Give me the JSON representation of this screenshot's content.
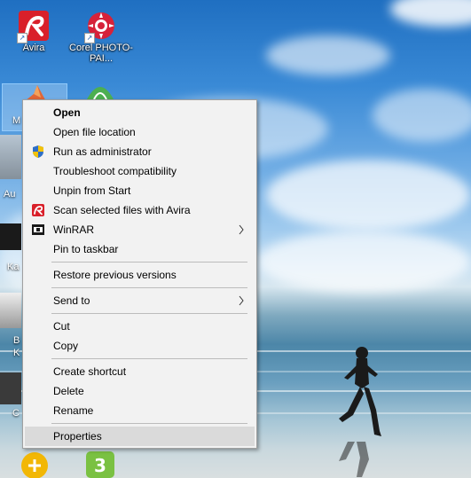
{
  "desktop": {
    "icons": [
      {
        "label": "Avira"
      },
      {
        "label": "Corel PHOTO-PAI..."
      }
    ],
    "partial_labels": [
      "M",
      "Au",
      "Ka",
      "B",
      "K",
      "C"
    ]
  },
  "context_menu": {
    "items": [
      {
        "label": "Open"
      },
      {
        "label": "Open file location"
      },
      {
        "label": "Run as administrator"
      },
      {
        "label": "Troubleshoot compatibility"
      },
      {
        "label": "Unpin from Start"
      },
      {
        "label": "Scan selected files with Avira"
      },
      {
        "label": "WinRAR"
      },
      {
        "label": "Pin to taskbar"
      },
      {
        "label": "Restore previous versions"
      },
      {
        "label": "Send to"
      },
      {
        "label": "Cut"
      },
      {
        "label": "Copy"
      },
      {
        "label": "Create shortcut"
      },
      {
        "label": "Delete"
      },
      {
        "label": "Rename"
      },
      {
        "label": "Properties"
      }
    ],
    "colors": {
      "hover": "#dadada",
      "background": "#f2f2f2",
      "separator": "#bcbcbc"
    }
  }
}
